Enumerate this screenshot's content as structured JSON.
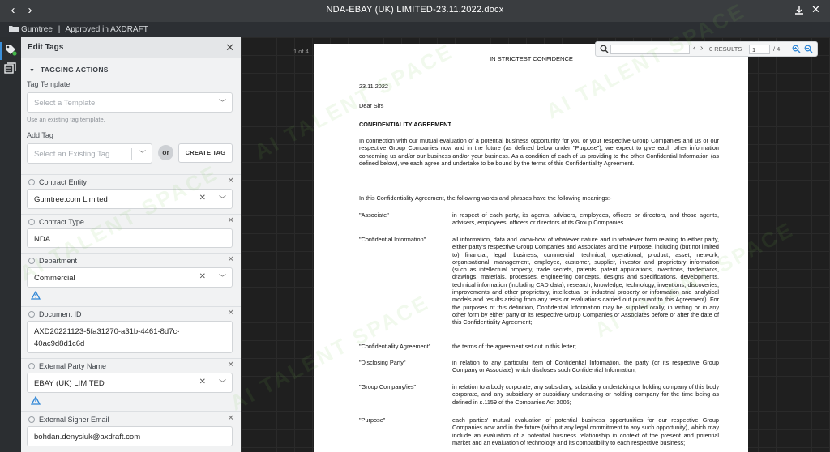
{
  "window": {
    "title": "NDA-EBAY (UK) LIMITED-23.11.2022.docx"
  },
  "breadcrumb": {
    "root": "Gumtree",
    "separator": "|",
    "current": "Approved in AXDRAFT"
  },
  "panel": {
    "title": "Edit Tags",
    "section_title": "TAGGING ACTIONS",
    "tag_template_label": "Tag Template",
    "tag_template_placeholder": "Select a Template",
    "tag_template_hint": "Use an existing tag template.",
    "add_tag_label": "Add Tag",
    "add_tag_placeholder": "Select an Existing Tag",
    "or_label": "or",
    "create_tag_label": "CREATE TAG",
    "fields": [
      {
        "name": "Contract Entity",
        "value": "Gumtree.com Limited"
      },
      {
        "name": "Contract Type",
        "value": "NDA"
      },
      {
        "name": "Department",
        "value": "Commercial"
      },
      {
        "name": "Document ID",
        "value_line1": "AXD20221123-5fa31270-a31b-4461-8d7c-",
        "value_line2": "40ac9d8d1c6d"
      },
      {
        "name": "External Party Name",
        "value": "EBAY (UK) LIMITED"
      },
      {
        "name": "External Signer Email",
        "value": "bohdan.denysiuk@axdraft.com"
      }
    ]
  },
  "viewer": {
    "page_indicator": "1 of 4",
    "search": {
      "results": "0 RESULTS",
      "page": "1",
      "total": "/ 4"
    }
  },
  "document": {
    "confidence": "IN STRICTEST CONFIDENCE",
    "date": "23.11.2022",
    "salutation": "Dear Sirs",
    "heading": "CONFIDENTIALITY AGREEMENT",
    "intro": "In connection with our mutual evaluation of a potential business opportunity for you or your respective Group Companies and us or our respective Group Companies now and in the future (as defined below under \"Purpose\"), we expect to give each other information concerning us and/or our business and/or your business.  As a condition of each of us providing to the other Confidential Information (as defined below), we each agree and undertake to be bound by the terms of this Confidentiality Agreement.",
    "meanings": "In this Confidentiality Agreement, the following words and phrases have the following meanings:-",
    "definitions": [
      {
        "term": "\"Associate\"",
        "text": "in respect of each party, its agents, advisers, employees, officers or directors, and those agents, advisers, employees, officers or directors of its Group Companies"
      },
      {
        "term": "\"Confidential Information\"",
        "text": "all information, data and know-how of whatever nature and in whatever form relating to either party, either party's respective Group Companies and Associates and the Purpose, including (but not limited to) financial, legal, business, commercial, technical, operational, product, asset, network, organisational, management, employee, customer, supplier, investor and proprietary information (such as intellectual property, trade secrets, patents, patent applications, inventions, trademarks, drawings, materials, processes, engineering concepts, designs and specifications, developments, technical information (including CAD data), research, knowledge, technology, inventions, discoveries, improvements and other proprietary, intellectual or industrial property or information and analytical models and results arising from any tests or evaluations carried out pursuant to this Agreement). For the purposes of this definition, Confidential Information may be supplied orally, in writing or in any other form by either party or its respective Group Companies or Associates before or after the date of this Confidentiality Agreement;"
      },
      {
        "term": "\"Confidentiality Agreement\"",
        "text": "the terms of the agreement set out in this letter;"
      },
      {
        "term": "\"Disclosing Party\"",
        "text": "in relation to any particular item of Confidential Information, the party (or its respective Group Company or Associate) which discloses such Confidential Information;"
      },
      {
        "term": "\"Group Company/ies\"",
        "text": "in relation to a body corporate, any subsidiary, subsidiary undertaking or holding company of this body corporate, and any subsidiary or subsidiary undertaking or holding company for the time being as defined in s.1159 of the Companies Act 2006;"
      },
      {
        "term": "\"Purpose\"",
        "text": "each parties' mutual evaluation of potential business opportunities for our respective Group Companies now and in the future (without any legal commitment to any such opportunity), which may include an evaluation of a potential business relationship in context of the present and potential market and an evaluation of technology and its compatibility to each respective business;"
      }
    ]
  },
  "watermark": "AI TALENT SPACE",
  "colors": {
    "accent": "#3b8fd9",
    "warning": "#2f86d6",
    "status_dot": "#43b649"
  }
}
